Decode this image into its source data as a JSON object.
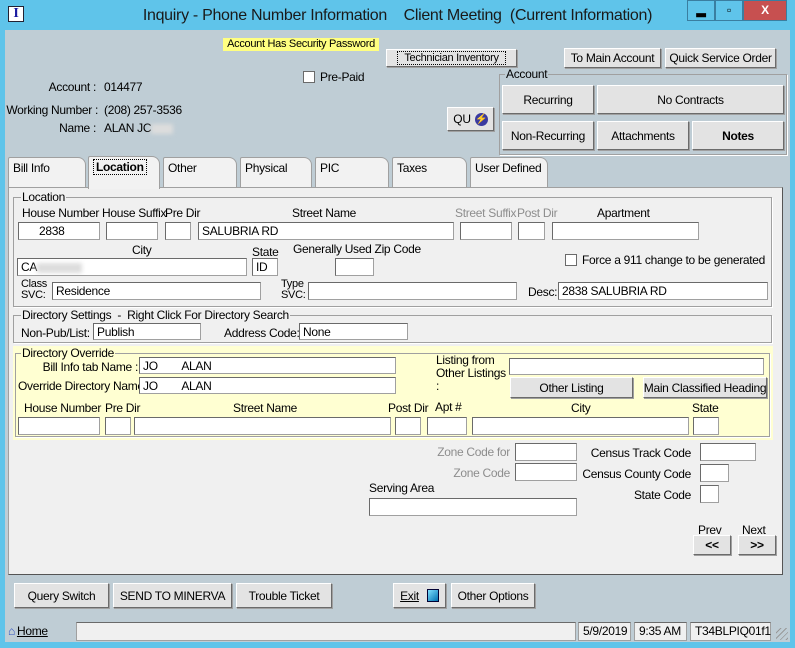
{
  "window": {
    "title": "Inquiry - Phone Number Information    Client Meeting  (Current Information)",
    "app_icon": "I",
    "minimize": "▂",
    "maximize": "▫",
    "close": "X"
  },
  "header": {
    "security_notice": "Account Has Security Password",
    "technician_inventory": "Technician Inventory",
    "to_main_account": "To Main Account",
    "quick_service_order": "Quick Service Order",
    "prepaid_label": "Pre-Paid",
    "prepaid_checked": false,
    "account_label": "Account :",
    "account_value": "014477",
    "working_number_label": "Working Number :",
    "working_number_value": "(208) 257-3536",
    "name_label": "Name :",
    "name_value": "ALAN JC",
    "qu_button": "QU"
  },
  "account_group": {
    "title": "Account",
    "recurring": "Recurring",
    "no_contracts": "No Contracts",
    "non_recurring": "Non-Recurring",
    "attachments": "Attachments",
    "notes": "Notes"
  },
  "tabs": [
    {
      "label": "Bill Info"
    },
    {
      "label": "Location",
      "selected": true
    },
    {
      "label": "Other"
    },
    {
      "label": "Physical"
    },
    {
      "label": "PIC"
    },
    {
      "label": "Taxes"
    },
    {
      "label": "User Defined"
    }
  ],
  "location": {
    "title": "Location",
    "labels": {
      "house_number": "House Number",
      "house_suffix": "House Suffix",
      "pre_dir": "Pre Dir",
      "street_name": "Street Name",
      "street_suffix": "Street Suffix",
      "post_dir": "Post Dir",
      "apartment": "Apartment",
      "city": "City",
      "state": "State",
      "zip": "Generally Used Zip Code",
      "class_svc": "Class SVC:",
      "type_svc": "Type SVC:",
      "desc": "Desc:"
    },
    "values": {
      "house_number": "2838",
      "house_suffix": "",
      "pre_dir": "",
      "street_name": "SALUBRIA RD",
      "street_suffix": "",
      "post_dir": "",
      "apartment": "",
      "city": "CA",
      "state": "ID",
      "zip": "",
      "class_svc": "Residence",
      "type_svc": "",
      "desc": "2838 SALUBRIA RD"
    },
    "force_911_label": "Force a 911 change to be generated",
    "force_911_checked": false
  },
  "directory_settings": {
    "title": "Directory Settings  -  Right Click For Directory Search",
    "non_pub_label": "Non-Pub/List:",
    "non_pub_value": "Publish",
    "address_code_label": "Address Code:",
    "address_code_value": "None"
  },
  "directory_override": {
    "title": "Directory Override",
    "bill_info_name_label": "Bill Info tab Name :",
    "bill_info_name_value": "JO        ALAN",
    "override_name_label": "Override Directory Name:",
    "override_name_value": "JO        ALAN",
    "listing_label": "Listing from Other Listings :",
    "listing_value": "",
    "other_listing": "Other Listing",
    "main_classified_heading": "Main Classified Heading",
    "labels": {
      "house_number": "House Number",
      "pre_dir": "Pre Dir",
      "street_name": "Street Name",
      "post_dir": "Post Dir",
      "apt": "Apt #",
      "city": "City",
      "state": "State"
    }
  },
  "misc": {
    "zone_code_marcom_label": "Zone Code for MARCOM",
    "zone_code_label": "Zone Code",
    "census_track_label": "Census Track Code",
    "census_county_label": "Census County Code",
    "state_code_label": "State Code",
    "serving_area_label": "Serving Area",
    "prev_label": "Prev",
    "next_label": "Next",
    "prev_button": "<<",
    "next_button": ">>"
  },
  "footer": {
    "query_switch": "Query Switch",
    "send_to_minerva": "SEND TO MINERVA",
    "trouble_ticket": "Trouble Ticket",
    "exit": "Exit",
    "other_options": "Other Options"
  },
  "status": {
    "home": "Home",
    "message": "",
    "date": "5/9/2019",
    "time": "9:35 AM",
    "screen_id": "T34BLPIQ01f1"
  },
  "colors": {
    "window_border": "#5fc4ea",
    "close_button": "#c75050",
    "security_notice_bg": "#ffff80",
    "override_bg": "#ffffd2"
  }
}
